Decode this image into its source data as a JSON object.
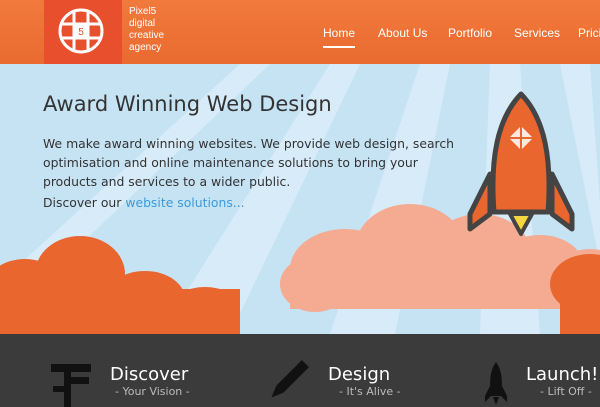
{
  "brand": {
    "logo_digit": "5",
    "lines": [
      "Pixel5",
      "digital",
      "creative",
      "agency"
    ]
  },
  "nav": {
    "items": [
      {
        "label": "Home",
        "active": true
      },
      {
        "label": "About Us",
        "active": false
      },
      {
        "label": "Portfolio",
        "active": false
      },
      {
        "label": "Services",
        "active": false
      },
      {
        "label": "Pricing",
        "active": false
      }
    ]
  },
  "hero": {
    "title": "Award Winning Web Design",
    "body": "We make award winning websites. We provide web design, search optimisation and online maintenance solutions to bring your products and services to a wider public.",
    "cta_prefix": "Discover our",
    "cta_link": "website solutions..."
  },
  "features": [
    {
      "title": "Discover",
      "subtitle": "- Your Vision -",
      "icon": "signpost-icon"
    },
    {
      "title": "Design",
      "subtitle": "- It's Alive -",
      "icon": "pencil-icon"
    },
    {
      "title": "Launch!",
      "subtitle": "- Lift Off -",
      "icon": "rocket-icon"
    }
  ],
  "colors": {
    "header_orange": "#ee7034",
    "logo_red": "#e84f2c",
    "sky_blue": "#c6e3f4",
    "link_blue": "#3a9ad9",
    "dark_footer": "#3b3b3b"
  }
}
